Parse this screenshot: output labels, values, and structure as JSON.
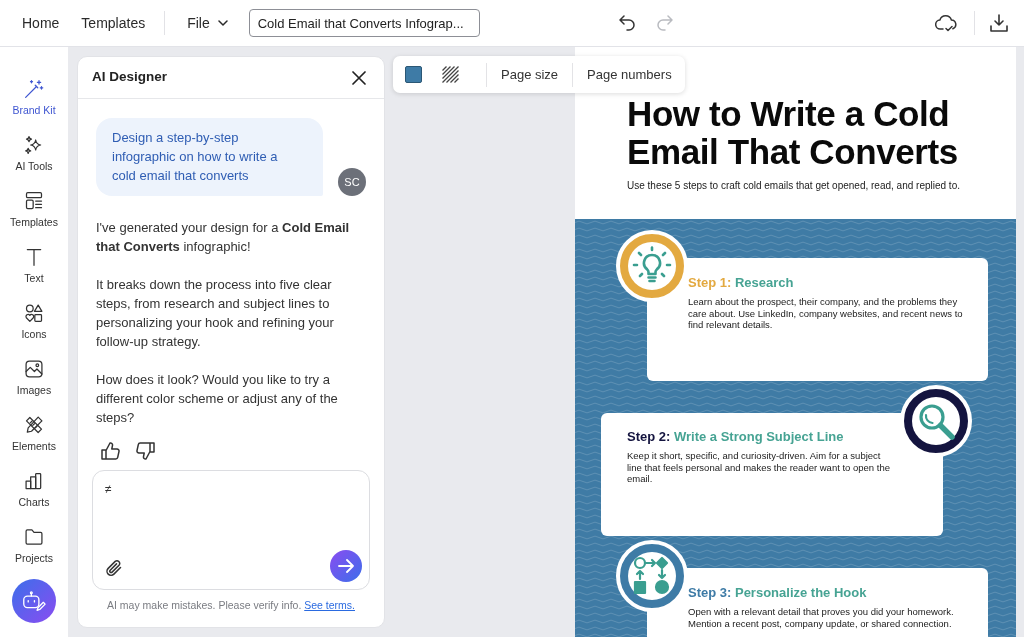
{
  "top_bar": {
    "nav_links": [
      {
        "label": "Home"
      },
      {
        "label": "Templates"
      }
    ],
    "file_menu": {
      "label": "File"
    },
    "document_title": {
      "value": "Cold Email that Converts Infograp..."
    },
    "history": [
      {
        "kind": "undo",
        "disabled": false
      },
      {
        "kind": "redo",
        "disabled": true
      }
    ]
  },
  "sidebar": {
    "items": [
      {
        "label": "Brand Kit",
        "selected": true
      },
      {
        "label": "AI Tools",
        "selected": false
      },
      {
        "label": "Templates",
        "selected": false
      },
      {
        "label": "Text",
        "selected": false
      },
      {
        "label": "Icons",
        "selected": false
      },
      {
        "label": "Images",
        "selected": false
      },
      {
        "label": "Elements",
        "selected": false
      },
      {
        "label": "Charts",
        "selected": false
      },
      {
        "label": "Projects",
        "selected": false
      }
    ]
  },
  "ai_panel": {
    "title": "AI Designer",
    "messages": [
      {
        "kind": "user",
        "text": "Design a step-by-step infographic on how to write a cold email that converts",
        "avatar": "SC"
      },
      {
        "kind": "assistant",
        "paragraphs": [
          "I've generated your design for a **Cold Email that Converts** infographic!",
          "It breaks down the process into five clear steps, from research and subject lines to personalizing your hook and refining your follow-up strategy.",
          "How does it look? Would you like to try a different color scheme or adjust any of the steps?"
        ]
      }
    ],
    "composer": {
      "value": "≠"
    },
    "disclaimer": {
      "text": "AI may make mistakes. Please verify info.",
      "link": "See terms."
    }
  },
  "page_toolbar": {
    "swatch": {
      "color": "#3e7ba6"
    },
    "items": [
      {
        "label": "Page size"
      },
      {
        "label": "Page numbers"
      }
    ]
  },
  "infographic": {
    "title": "How to Write a Cold Email That Converts",
    "subtitle": "Use these 5 steps to craft cold emails that get opened, read, and replied to.",
    "steps": [
      {
        "label": "Step 1:",
        "title": "Research",
        "color": "#e3a940",
        "text": "Learn about the prospect, their company, and the problems they care about. Use LinkedIn, company websites, and recent news to find relevant details."
      },
      {
        "label": "Step 2:",
        "title": "Write a Strong Subject Line",
        "color": "#14143f",
        "text": "Keep it short, specific, and curiosity-driven. Aim for a subject line that feels personal and makes the reader want to open the email."
      },
      {
        "label": "Step 3:",
        "title": "Personalize the Hook",
        "color": "#3e7ba6",
        "text": "Open with a relevant detail that proves you did your homework. Mention a recent post, company update, or shared connection."
      }
    ]
  }
}
